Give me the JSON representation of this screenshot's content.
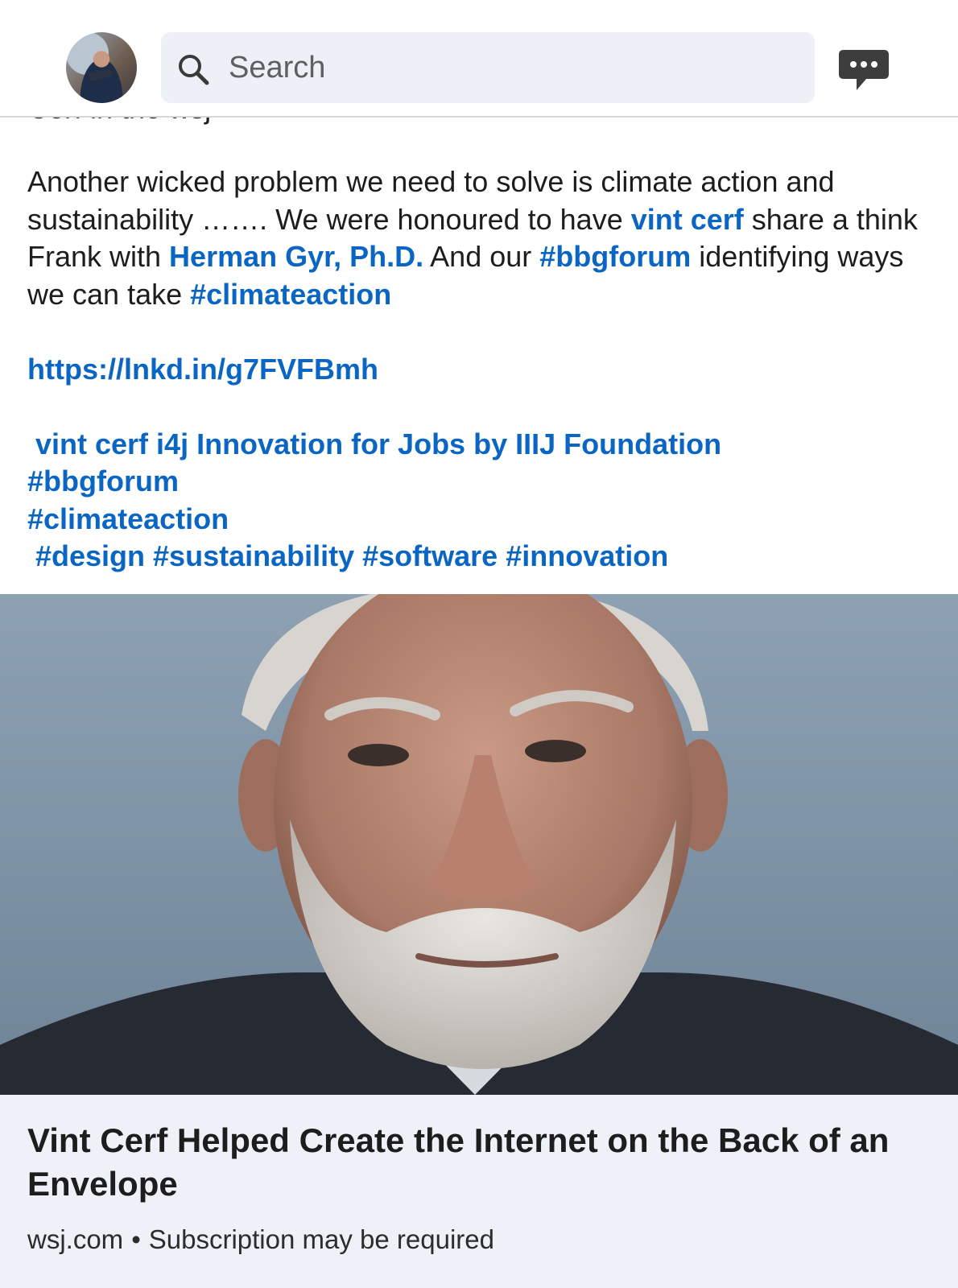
{
  "header": {
    "search_placeholder": "Search",
    "icons": [
      "avatar",
      "search-icon",
      "messaging-icon"
    ]
  },
  "post": {
    "clipped_line": "Cerf in the wsj",
    "paragraph1": {
      "t1": "Another wicked problem we need to solve is climate action and sustainability ……. We were honoured to have ",
      "mention1": "vint cerf",
      "t2": " share a think Frank with ",
      "mention2": "Herman Gyr, Ph.D.",
      "t3": " And our ",
      "hashtag1": "#bbgforum",
      "t4": " identifying ways we can take ",
      "hashtag2": "#climateaction"
    },
    "url": "https://lnkd.in/g7FVFBmh",
    "tags_line1": "vint cerf i4j Innovation for Jobs by IIIJ Foundation",
    "tags_line2": "#bbgforum",
    "tags_line3": "#climateaction",
    "tags_line4": "#design #sustainability #software #innovation"
  },
  "article": {
    "title": "Vint Cerf Helped Create the Internet on the Back of an Envelope",
    "source": "wsj.com",
    "separator": "•",
    "note": "Subscription may be required"
  },
  "colors": {
    "link": "#0a66c2",
    "card_bg": "#eef1f7",
    "search_bg": "#edf1f7"
  }
}
